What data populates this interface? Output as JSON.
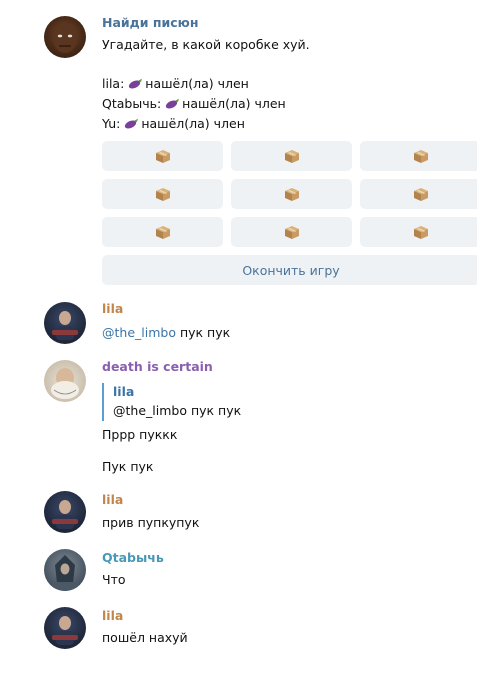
{
  "messages": {
    "m1": {
      "author": "Найди писюн",
      "author_color": "#4a7399",
      "text": "Угадайте, в какой коробке хуй.",
      "results": [
        {
          "user": "lila:",
          "result": "нашёл(ла) член"
        },
        {
          "user": "Qtabычь:",
          "result": "нашёл(ла) член"
        },
        {
          "user": "Yu:",
          "result": "нашёл(ла) член"
        }
      ],
      "box_icon": "package-icon",
      "finish_label": "Окончить игру"
    },
    "m2": {
      "author": "lila",
      "author_color": "#c0864c",
      "mention": "@the_limbo",
      "text": " пук пук"
    },
    "m3": {
      "author": "death is certain",
      "author_color": "#8a5fb0",
      "quote_author": "lila",
      "quote_mention": "@the_limbo",
      "quote_text": " пук пук",
      "line1": "Пррр пуккк",
      "line2": "Пук пук"
    },
    "m4": {
      "author": "lila",
      "author_color": "#c0864c",
      "text": "прив пупкупук"
    },
    "m5": {
      "author": "Qtabычь",
      "author_color": "#4a98b8",
      "text": "Что"
    },
    "m6": {
      "author": "lila",
      "author_color": "#c0864c",
      "text": "пошёл нахуй"
    }
  }
}
